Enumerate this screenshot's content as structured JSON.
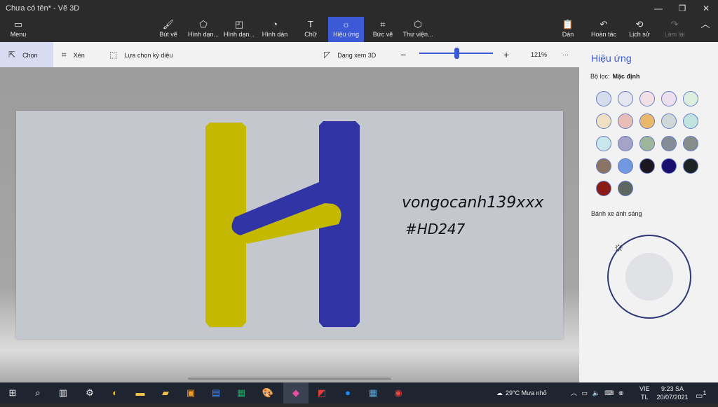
{
  "window": {
    "title": "Chưa có tên* - Vẽ 3D"
  },
  "ribbon": {
    "menu": "Menu",
    "tools": [
      "Bút vẽ",
      "Hình dạn...",
      "Hình dạn...",
      "Hình dán",
      "Chữ",
      "Hiệu ứng",
      "Bức vẽ",
      "Thư viện..."
    ],
    "right": [
      "Dán",
      "Hoàn tác",
      "Lịch sử",
      "Làm lại"
    ]
  },
  "toolbar": {
    "select": "Chọn",
    "crop": "Xén",
    "magic_select": "Lựa chọn kỳ diệu",
    "view3d": "Dạng xem 3D",
    "zoom": "121%",
    "more": "···"
  },
  "canvas_text": {
    "line1": "vongocanh139xxx",
    "line2": "#HD247"
  },
  "panel": {
    "title": "Hiệu ứng",
    "filter_label": "Bộ lọc:",
    "filter_value": "Mặc định",
    "swatches": [
      "#d5dcec",
      "#e6e6f1",
      "#f3dfe6",
      "#ece0ef",
      "#dcefdf",
      "#f0e0c2",
      "#e8beb6",
      "#e9b86b",
      "#cfd8d7",
      "#bfe4df",
      "#c9e6ec",
      "#a6a4c6",
      "#9fb59b",
      "#848c98",
      "#868c8a",
      "#8a7565",
      "#7299e0",
      "#1c1620",
      "#1b0f6e",
      "#1d2426",
      "#8a1a16",
      "#5d6661"
    ],
    "wheel_label": "Bánh xe ánh sáng"
  },
  "taskbar": {
    "weather": "29°C  Mưa nhỏ",
    "lang1": "VIE",
    "lang2": "TL",
    "time": "9:23 SA",
    "date": "20/07/2021",
    "notif": "1"
  }
}
